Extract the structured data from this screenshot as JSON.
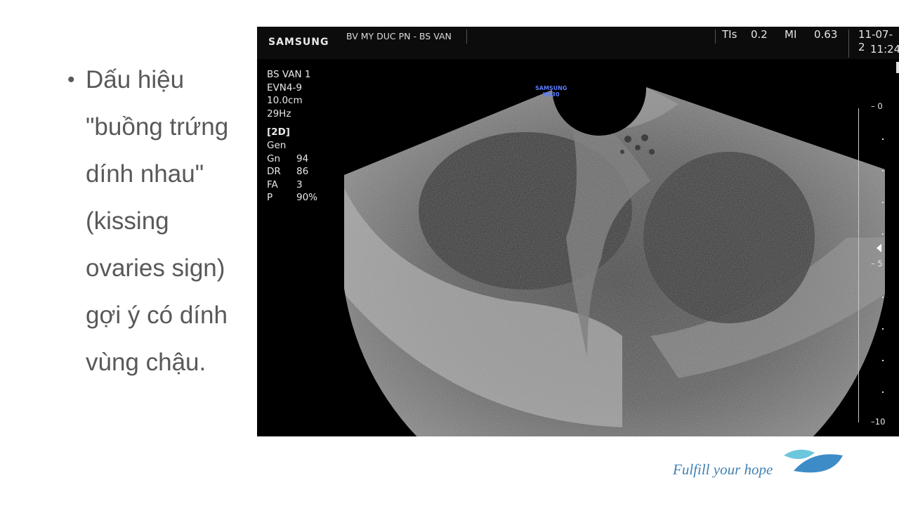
{
  "slide": {
    "bullet": "•",
    "lines": [
      "Dấu hiệu",
      "\"buồng trứng",
      "dính nhau\"",
      "(kissing",
      "ovaries sign)",
      "gợi ý có dính",
      "vùng chậu."
    ]
  },
  "ultrasound": {
    "brand": "SAMSUNG",
    "facility": "BV MY DUC PN - BS VAN",
    "tis_label": "TIs",
    "tis_value": "0.2",
    "mi_label": "MI",
    "mi_value": "0.63",
    "date": "11-07-2",
    "time": "11:24",
    "params": {
      "operator": "BS VAN 1",
      "probe": "EVN4-9",
      "depth": "10.0cm",
      "frame_rate": "29Hz",
      "mode": "[2D]",
      "preset": "Gen",
      "rows": [
        {
          "k": "Gn",
          "v": "94"
        },
        {
          "k": "DR",
          "v": "86"
        },
        {
          "k": "FA",
          "v": "3"
        },
        {
          "k": "P",
          "v": "90%"
        }
      ]
    },
    "probe_label": [
      "SAMSUNG",
      "HS30"
    ],
    "scale": {
      "top": "0",
      "mid": "5",
      "bottom": "10"
    }
  },
  "footer": {
    "tagline": "Fulfill your hope",
    "logo_colors": {
      "light": "#6cc6dd",
      "dark": "#3d8cc7"
    }
  }
}
